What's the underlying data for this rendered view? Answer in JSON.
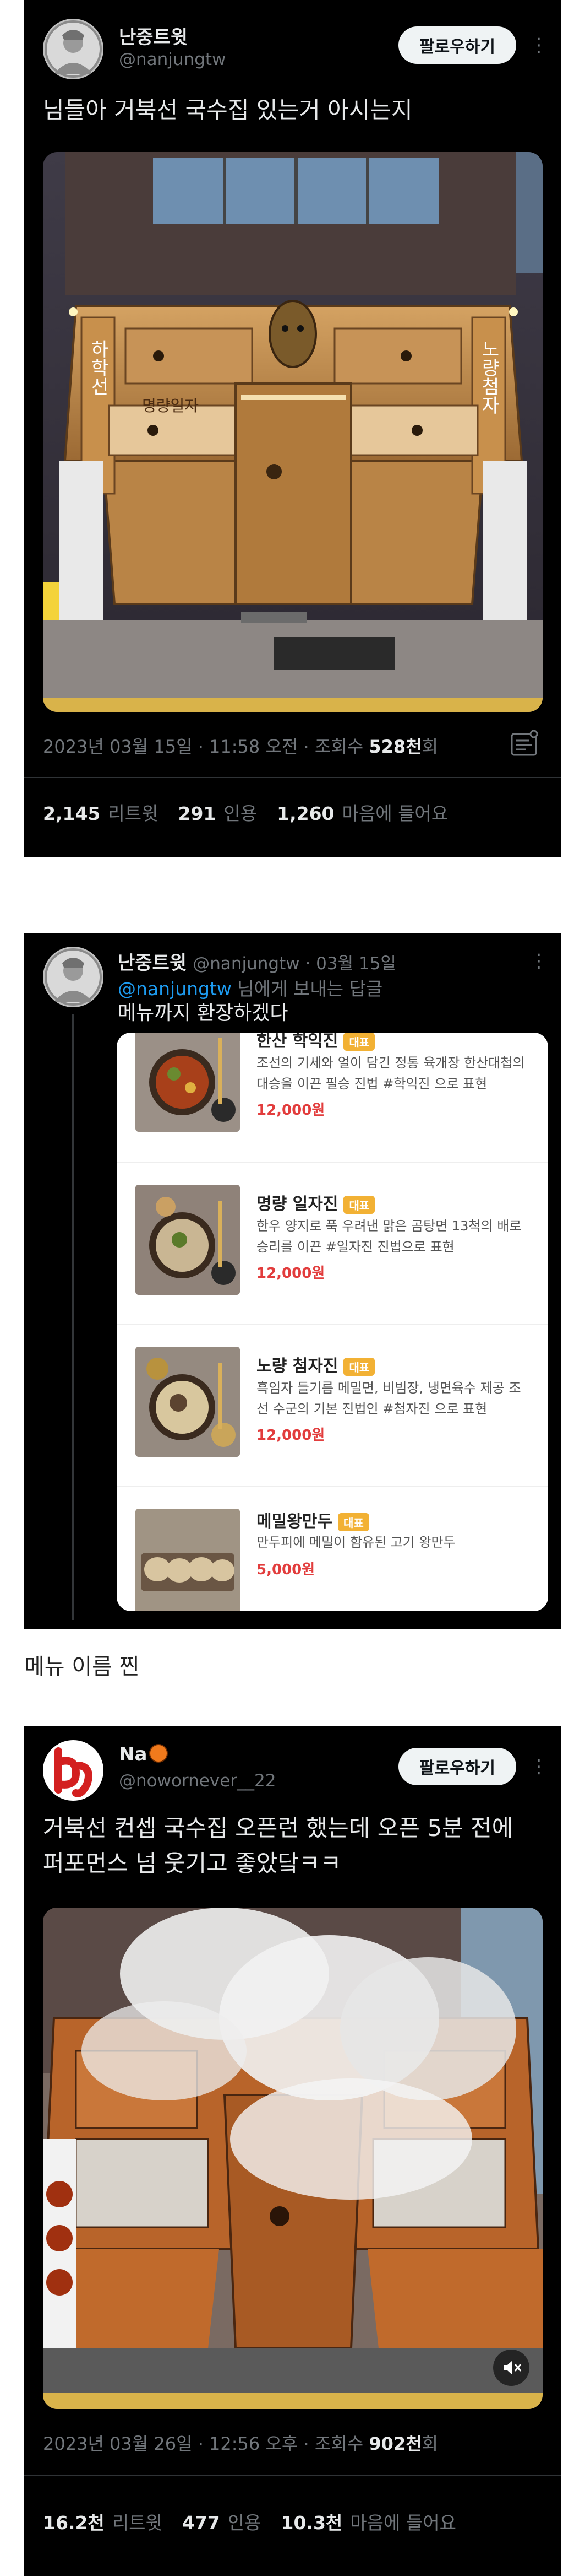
{
  "tweet1": {
    "display_name": "난중트윗",
    "handle": "@nanjungtw",
    "follow_label": "팔로우하기",
    "text": "님들아 거북선 국수집 있는거 아시는지",
    "signboard": [
      "하학선",
      "명량일자",
      "노량첨자"
    ],
    "meta_prefix": "2023년 03월 15일 · 11:58 오전 · 조회수 ",
    "views": "528천",
    "views_suffix": "회",
    "retweets": "2,145",
    "retweets_label": "리트윗",
    "quotes": "291",
    "quotes_label": "인용",
    "likes": "1,260",
    "likes_label": "마음에 들어요"
  },
  "tweet2": {
    "display_name": "난중트윗",
    "handle_date": "@nanjungtw · 03월 15일",
    "reply_to_handle": "@nanjungtw",
    "reply_to_suffix": " 님에게 보내는 답글",
    "text": "메뉴까지 환장하겠다",
    "menu": [
      {
        "name": "한산 학익진",
        "badge": "대표",
        "desc": "조선의 기세와 얼이 담긴 정통 육개장 한산대첩의 대승을 이끈 필승 진법 #학익진 으로 표현",
        "price": "12,000원"
      },
      {
        "name": "명량 일자진",
        "badge": "대표",
        "desc": "한우 양지로 푹 우려낸 맑은 곰탕면 13척의 배로 승리를 이끈 #일자진 진법으로 표현",
        "price": "12,000원"
      },
      {
        "name": "노량 첨자진",
        "badge": "대표",
        "desc": "흑임자 들기름 메밀면, 비빔장, 냉면육수 제공 조선 수군의 기본 진법인 #첨자진 으로 표현",
        "price": "12,000원"
      },
      {
        "name": "메밀왕만두",
        "badge": "대표",
        "desc": "만두피에 메밀이 함유된 고기 왕만두",
        "price": "5,000원"
      }
    ]
  },
  "caption": "메뉴 이름 찐",
  "tweet3": {
    "display_name": "Na",
    "handle": "@nowornever__22",
    "follow_label": "팔로우하기",
    "text_line1": "거북선 컨셉 국수집 오픈런 했는데 오픈 5분 전에",
    "text_line2": "퍼포먼스 넘 웃기고 좋았닼ㅋㅋ",
    "meta_prefix": "2023년 03월 26일 · 12:56 오후 · 조회수 ",
    "views": "902천",
    "views_suffix": "회",
    "retweets": "16.2천",
    "retweets_label": "리트윗",
    "quotes": "477",
    "quotes_label": "인용",
    "likes": "10.3천",
    "likes_label": "마음에 들어요"
  },
  "icons": {
    "more": "more-vertical-icon",
    "analytics": "analytics-icon",
    "mute": "speaker-mute-icon"
  },
  "colors": {
    "background": "#000000",
    "text": "#e7e9ea",
    "secondary": "#71767b",
    "link": "#1d9bf0",
    "price": "#e23d3d",
    "badge": "#f2b134"
  }
}
